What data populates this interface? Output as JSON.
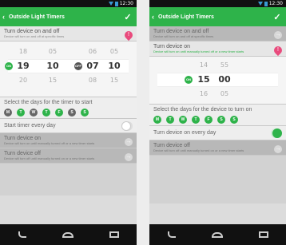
{
  "status": {
    "time": "12:30"
  },
  "left": {
    "appbar": {
      "title": "Outside Light Timers"
    },
    "row_on_off": {
      "label": "Turn device on and off",
      "sub": "Device will turn on and off at specific times"
    },
    "picker": {
      "hours_left": [
        "18",
        "19",
        "20"
      ],
      "mins_left": [
        "05",
        "10",
        "15"
      ],
      "hours_right": [
        "06",
        "07",
        "08"
      ],
      "mins_right": [
        "05",
        "10",
        "15"
      ],
      "on_label": "ON",
      "off_label": "OFF"
    },
    "days": {
      "label": "Select the days for the timer to start",
      "items": [
        "M",
        "T",
        "W",
        "T",
        "F",
        "S",
        "S"
      ],
      "active": [
        false,
        true,
        false,
        true,
        true,
        false,
        true
      ]
    },
    "toggle": {
      "label": "Start timer every day",
      "state": "off"
    },
    "row_on": {
      "label": "Turn device on",
      "sub": "Device will turn on until manually turned off or a new timer starts"
    },
    "row_off": {
      "label": "Turn device off",
      "sub": "Device will turn off until manually turned on or a new timer starts"
    }
  },
  "right": {
    "appbar": {
      "title": "Outside Light Timers"
    },
    "row_on_off": {
      "label": "Turn device on and off",
      "sub": "Device will turn on and off at specific times"
    },
    "row_on": {
      "label": "Turn device on",
      "sub": "Device will turn on until manually turned off or a new timer starts"
    },
    "picker": {
      "hours": [
        "14",
        "15",
        "16"
      ],
      "mins": [
        "55",
        "00",
        "05"
      ],
      "on_label": "ON"
    },
    "days": {
      "label": "Select the days for the device to turn on",
      "items": [
        "M",
        "T",
        "W",
        "T",
        "F",
        "S",
        "S"
      ],
      "active": [
        true,
        true,
        true,
        true,
        true,
        true,
        true
      ]
    },
    "toggle": {
      "label": "Turn device on every day",
      "state": "on"
    },
    "row_off": {
      "label": "Turn device off",
      "sub": "Device will turn off until manually turned on or a new timer starts"
    }
  },
  "colors": {
    "accent": "#2eb34a",
    "pin": "#e94b7d"
  }
}
